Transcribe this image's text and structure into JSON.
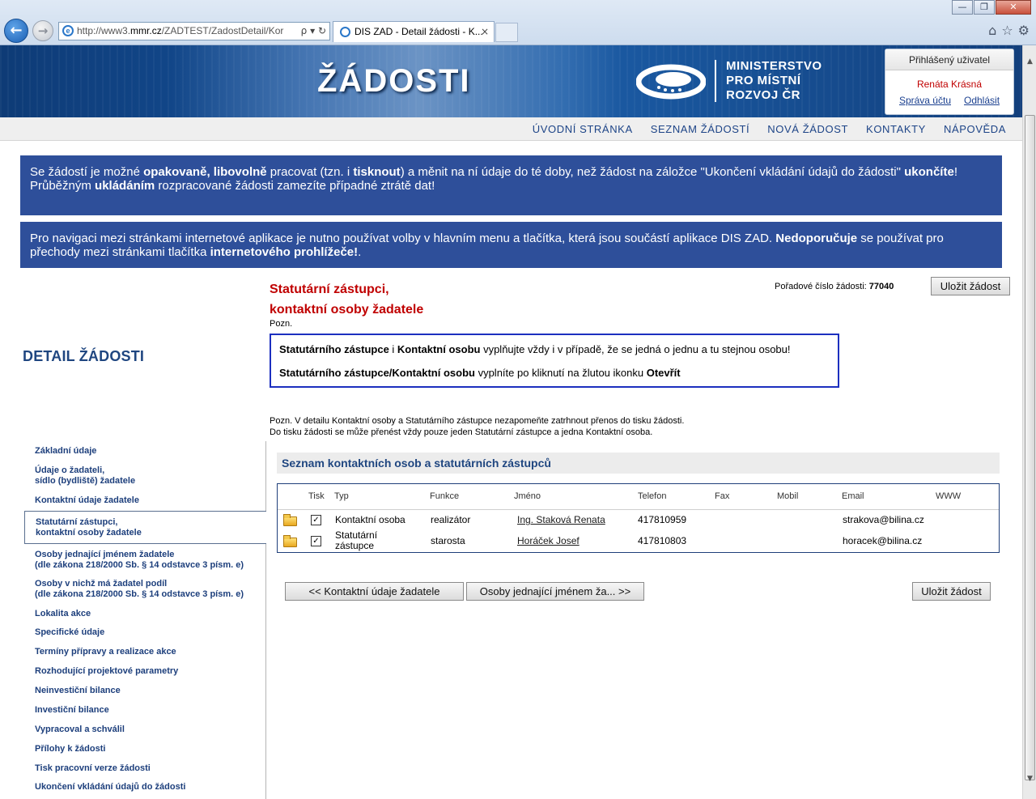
{
  "browser": {
    "url_prefix": "http://www3.",
    "url_domain": "mmr.cz",
    "url_rest": "/ZADTEST/ZadostDetail/Kor",
    "url_tools": "ρ ▾ ↻",
    "tab_title": "DIS ZAD - Detail žádosti - K...",
    "tab_close": "×",
    "window_controls": [
      "—",
      "❐",
      "✕"
    ],
    "back_glyph": "←",
    "forward_glyph": "→",
    "toolbar_icons": {
      "home": "⌂",
      "favorites": "☆",
      "settings": "⚙"
    }
  },
  "header": {
    "site_title": "ŽÁDOSTI",
    "ministry_lines": [
      "MINISTERSTVO",
      "PRO MÍSTNÍ",
      "ROZVOJ ČR"
    ],
    "user_box": {
      "title": "Přihlášený uživatel",
      "name": "Renáta Krásná",
      "account_link": "Správa účtu",
      "logout_link": "Odhlásit"
    }
  },
  "topnav": [
    "ÚVODNÍ STRÁNKA",
    "SEZNAM ŽÁDOSTÍ",
    "NOVÁ ŽÁDOST",
    "KONTAKTY",
    "NÁPOVĚDA"
  ],
  "info1": {
    "t1": "Se žádostí je možné ",
    "b1": "opakovaně, libovolně",
    "t2": " pracovat (tzn. i ",
    "b2": "tisknout",
    "t3": ") a měnit na ní údaje do té doby, než žádost na záložce \"Ukončení vkládání údajů do žádosti\" ",
    "b3": "ukončíte",
    "t4": "!",
    "t5": "Průběžným ",
    "b4": "ukládáním",
    "t6": " rozpracované žádosti zamezíte případné ztrátě dat!"
  },
  "info2": {
    "t1": "Pro navigaci mezi stránkami internetové aplikace je nutno používat volby v hlavním menu a tlačítka, která jsou součástí aplikace DIS ZAD. ",
    "b1": "Nedoporučuje",
    "t2": " se používat pro přechody mezi stránkami tlačítka ",
    "b2": "internetového prohlížeče!",
    "t3": "."
  },
  "detail_title": "DETAIL ŽÁDOSTI",
  "sidebar": {
    "items": [
      {
        "l1": "Základní údaje",
        "l2": ""
      },
      {
        "l1": "Údaje o žadateli,",
        "l2": "sídlo (bydliště) žadatele"
      },
      {
        "l1": "Kontaktní údaje žadatele",
        "l2": ""
      },
      {
        "l1": "Statutární zástupci,",
        "l2": "kontaktní osoby žadatele"
      },
      {
        "l1": "Osoby jednající jménem žadatele",
        "l2": "(dle zákona 218/2000 Sb. § 14 odstavce 3 písm. e)"
      },
      {
        "l1": "Osoby v nichž má žadatel podíl",
        "l2": "(dle zákona 218/2000 Sb. § 14 odstavce 3 písm. e)"
      },
      {
        "l1": "Lokalita akce",
        "l2": ""
      },
      {
        "l1": "Specifické údaje",
        "l2": ""
      },
      {
        "l1": "Termíny přípravy a realizace akce",
        "l2": ""
      },
      {
        "l1": "Rozhodující projektové parametry",
        "l2": ""
      },
      {
        "l1": "Neinvestiční bilance",
        "l2": ""
      },
      {
        "l1": "Investiční bilance",
        "l2": ""
      },
      {
        "l1": "Vypracoval a schválil",
        "l2": ""
      },
      {
        "l1": "Přílohy k žádosti",
        "l2": ""
      },
      {
        "l1": "Tisk pracovní verze žádosti",
        "l2": ""
      },
      {
        "l1": "Ukončení vkládání údajů do žádosti",
        "l2": ""
      }
    ]
  },
  "main": {
    "title_line1": "Statutární zástupci,",
    "title_line2": "kontaktní osoby žadatele",
    "pozn1": "Pozn.",
    "order_label": "Pořadové číslo žádosti:",
    "order_number": "77040",
    "save_label": "Uložit žádost",
    "note1": {
      "b1": "Statutárního zástupce",
      "t1": " i ",
      "b2": "Kontaktní osobu",
      "t2": " vyplňujte vždy i v případě, že se jedná o jednu a tu stejnou osobu!"
    },
    "note2": {
      "b1": "Statutárního zástupce/Kontaktní osobu",
      "t1": " vyplníte po kliknutí na žlutou ikonku ",
      "b2": "Otevřít"
    },
    "pozn2_line1": "Pozn. V detailu Kontaktní osoby a Statutárního zástupce nezapomeňte zatrhnout přenos do tisku žádosti.",
    "pozn2_line2": "Do tisku žádosti se může přenést vždy pouze jeden Statutární zástupce a jedna Kontaktní osoba.",
    "list_title": "Seznam kontaktních osob a statutárních zástupců",
    "columns": [
      "Tisk",
      "Typ",
      "Funkce",
      "Jméno",
      "Telefon",
      "Fax",
      "Mobil",
      "Email",
      "WWW"
    ],
    "rows": [
      {
        "tisk": "✓",
        "typ1": "Kontaktní osoba",
        "typ2": "",
        "funkce": "realizátor",
        "jmeno": "Ing. Staková Renata",
        "telefon": "417810959",
        "fax": "",
        "mobil": "",
        "email": "strakova@bilina.cz",
        "www": ""
      },
      {
        "tisk": "✓",
        "typ1": "Statutární",
        "typ2": "zástupce",
        "funkce": "starosta",
        "jmeno": "Horáček Josef",
        "telefon": "417810803",
        "fax": "",
        "mobil": "",
        "email": "horacek@bilina.cz",
        "www": ""
      }
    ],
    "prev_button": "<<  Kontaktní údaje žadatele",
    "next_button": "Osoby jednající jménem ža...  >>"
  },
  "scrollbar": {
    "up": "▲",
    "down": "▼"
  },
  "colors": {
    "banner": "#144e96",
    "infobox": "#2e4f9a",
    "red_title": "#c00000",
    "nav_text": "#1d4487",
    "note_border": "#1c2fbf"
  }
}
